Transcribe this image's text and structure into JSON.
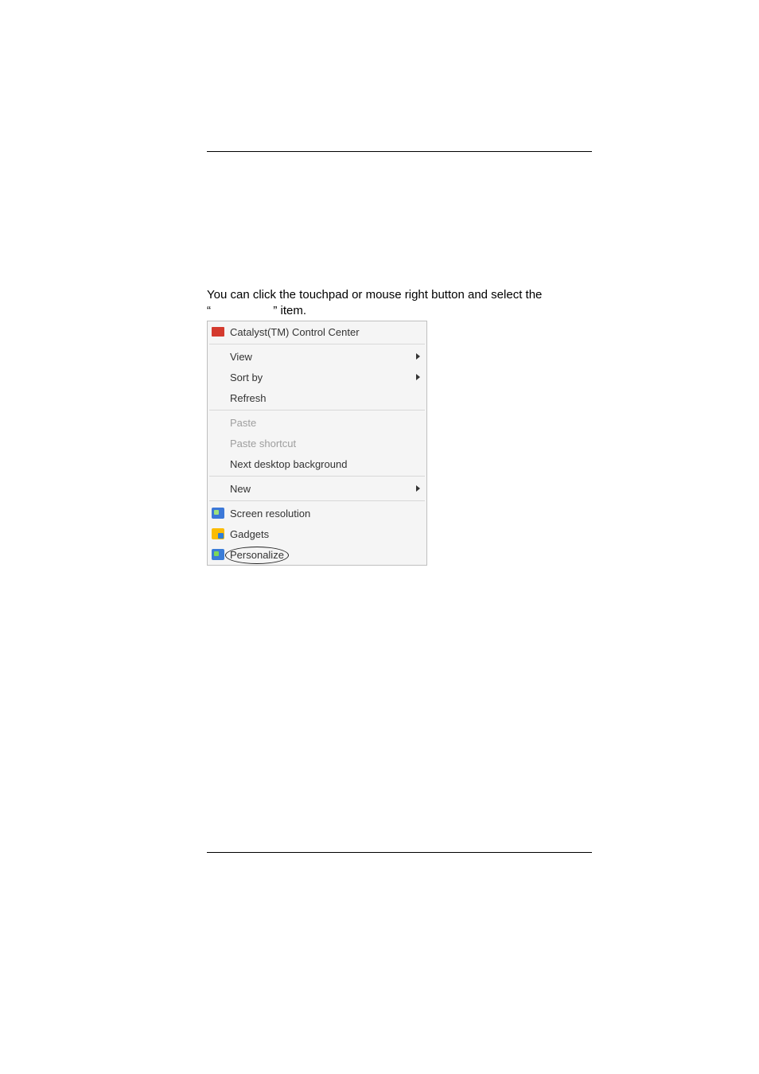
{
  "instruction": {
    "line1": "You can click the touchpad or mouse right button and select the",
    "line2_prefix": "“",
    "line2_suffix": "” item."
  },
  "context_menu": {
    "items": [
      {
        "id": "catalyst",
        "label": "Catalyst(TM) Control Center",
        "icon": "ati-icon",
        "submenu": false,
        "disabled": false
      },
      {
        "id": "view",
        "label": "View",
        "icon": null,
        "submenu": true,
        "disabled": false
      },
      {
        "id": "sortby",
        "label": "Sort by",
        "icon": null,
        "submenu": true,
        "disabled": false
      },
      {
        "id": "refresh",
        "label": "Refresh",
        "icon": null,
        "submenu": false,
        "disabled": false
      },
      {
        "id": "paste",
        "label": "Paste",
        "icon": null,
        "submenu": false,
        "disabled": true
      },
      {
        "id": "pastesc",
        "label": "Paste shortcut",
        "icon": null,
        "submenu": false,
        "disabled": true
      },
      {
        "id": "nextbg",
        "label": "Next desktop background",
        "icon": null,
        "submenu": false,
        "disabled": false
      },
      {
        "id": "new",
        "label": "New",
        "icon": null,
        "submenu": true,
        "disabled": false
      },
      {
        "id": "screenres",
        "label": "Screen resolution",
        "icon": "screenres-icon",
        "submenu": false,
        "disabled": false
      },
      {
        "id": "gadgets",
        "label": "Gadgets",
        "icon": "gadgets-icon",
        "submenu": false,
        "disabled": false
      },
      {
        "id": "personalize",
        "label": "Personalize",
        "icon": "personalize-icon",
        "submenu": false,
        "disabled": false,
        "circled": true
      }
    ]
  }
}
